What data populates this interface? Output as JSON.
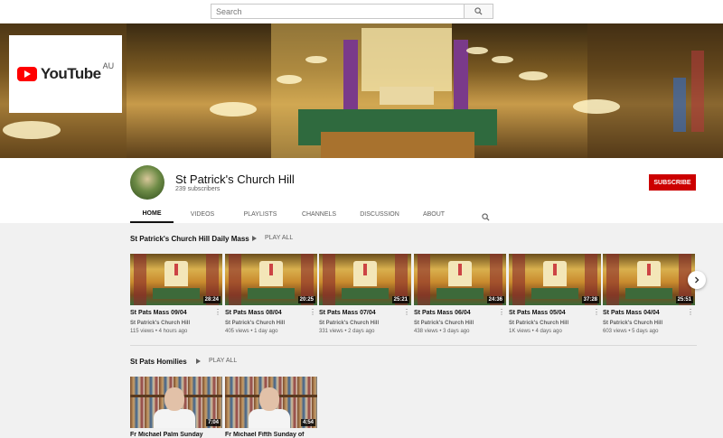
{
  "search": {
    "placeholder": "Search"
  },
  "logo": {
    "wordmark": "YouTube",
    "region": "AU"
  },
  "channel": {
    "name": "St Patrick's Church Hill",
    "subscribers": "239 subscribers",
    "subscribe_label": "SUBSCRIBE"
  },
  "tabs": [
    {
      "label": "HOME"
    },
    {
      "label": "VIDEOS"
    },
    {
      "label": "PLAYLISTS"
    },
    {
      "label": "CHANNELS"
    },
    {
      "label": "DISCUSSION"
    },
    {
      "label": "ABOUT"
    }
  ],
  "shelf1": {
    "title": "St Patrick's Church Hill Daily Mass",
    "play_all": "PLAY ALL",
    "videos": [
      {
        "title": "St Pats Mass 09/04",
        "channel": "St Patrick's Church Hill",
        "meta": "115 views • 4 hours ago",
        "duration": "28:24"
      },
      {
        "title": "St Pats Mass 08/04",
        "channel": "St Patrick's Church Hill",
        "meta": "405 views • 1 day ago",
        "duration": "20:25"
      },
      {
        "title": "St Pats Mass 07/04",
        "channel": "St Patrick's Church Hill",
        "meta": "331 views • 2 days ago",
        "duration": "25:21"
      },
      {
        "title": "St Pats Mass 06/04",
        "channel": "St Patrick's Church Hill",
        "meta": "438 views • 3 days ago",
        "duration": "24:36"
      },
      {
        "title": "St Pats Mass 05/04",
        "channel": "St Patrick's Church Hill",
        "meta": "1K views • 4 days ago",
        "duration": "37:28"
      },
      {
        "title": "St Pats Mass 04/04",
        "channel": "St Patrick's Church Hill",
        "meta": "603 views • 5 days ago",
        "duration": "25:51"
      }
    ]
  },
  "shelf2": {
    "title": "St Pats Homilies",
    "play_all": "PLAY ALL",
    "videos": [
      {
        "title": "Fr Michael Palm Sunday",
        "duration": "7:04"
      },
      {
        "title": "Fr Michael Fifth Sunday of",
        "duration": "4:54"
      }
    ]
  },
  "icons": {
    "search": "search-icon",
    "next": "chevron-right-icon",
    "more": "more-vert-icon",
    "play": "play-icon"
  },
  "colors": {
    "subscribe": "#cc0000",
    "brand": "#ff0000"
  }
}
